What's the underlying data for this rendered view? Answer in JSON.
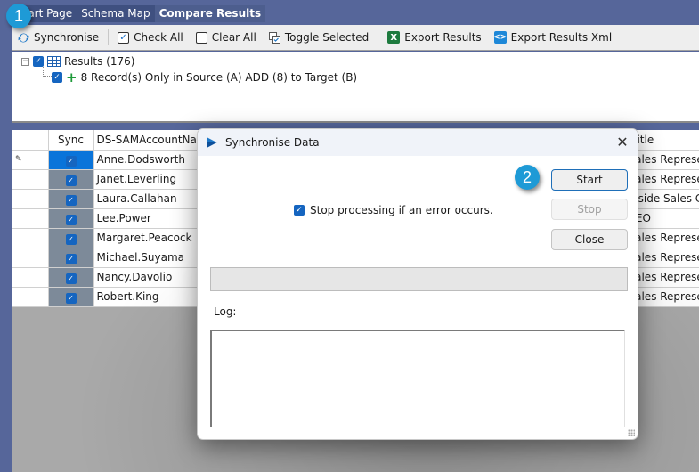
{
  "tabs": [
    {
      "label": "Start Page",
      "active": false
    },
    {
      "label": "Schema Map",
      "active": false
    },
    {
      "label": "Compare Results",
      "active": true
    }
  ],
  "toolbar": {
    "synchronise": {
      "label": "Synchronise",
      "icon": "sync-icon"
    },
    "check_all": {
      "label": "Check All",
      "icon": "checkbox-checked-icon"
    },
    "clear_all": {
      "label": "Clear All",
      "icon": "checkbox-empty-icon"
    },
    "toggle_selected": {
      "label": "Toggle Selected",
      "icon": "toggle-selected-icon"
    },
    "export_results": {
      "label": "Export Results",
      "icon": "excel-icon",
      "icon_glyph": "X"
    },
    "export_results_xml": {
      "label": "Export Results Xml",
      "icon": "xml-icon",
      "icon_glyph": "<>"
    }
  },
  "tree": {
    "root": {
      "label": "Results (176)",
      "checked": true,
      "expanded": true
    },
    "children": [
      {
        "label": "8 Record(s) Only in Source (A) ADD (8) to Target (B)",
        "checked": true
      }
    ]
  },
  "grid": {
    "columns": [
      "",
      "Sync",
      "DS-SAMAccountNar",
      "Title"
    ],
    "rows": [
      {
        "name": "Anne.Dodsworth",
        "title": "Sales Represen",
        "sync": true,
        "current": true,
        "indicator": "✎"
      },
      {
        "name": "Janet.Leverling",
        "title": "Sales Represen",
        "sync": true
      },
      {
        "name": "Laura.Callahan",
        "title": "Inside Sales Co",
        "sync": true
      },
      {
        "name": "Lee.Power",
        "title": "CEO",
        "sync": true
      },
      {
        "name": "Margaret.Peacock",
        "title": "Sales Represen",
        "sync": true
      },
      {
        "name": "Michael.Suyama",
        "title": "Sales Represen",
        "sync": true
      },
      {
        "name": "Nancy.Davolio",
        "title": "Sales Represen",
        "sync": true
      },
      {
        "name": "Robert.King",
        "title": "Sales Represen",
        "sync": true
      }
    ]
  },
  "dialog": {
    "title": "Synchronise Data",
    "close_glyph": "✕",
    "start_label": "Start",
    "stop_label": "Stop",
    "close_label": "Close",
    "stop_on_error_label": "Stop processing if an error occurs.",
    "stop_on_error_checked": true,
    "progress": 0,
    "log_label": "Log:",
    "log_value": ""
  },
  "callouts": [
    "1",
    "2"
  ],
  "colors": {
    "accent": "#1e9ad6",
    "checkbox": "#1565c0",
    "selected_cell": "#0a74da",
    "tab_bar": "#3f5080"
  }
}
